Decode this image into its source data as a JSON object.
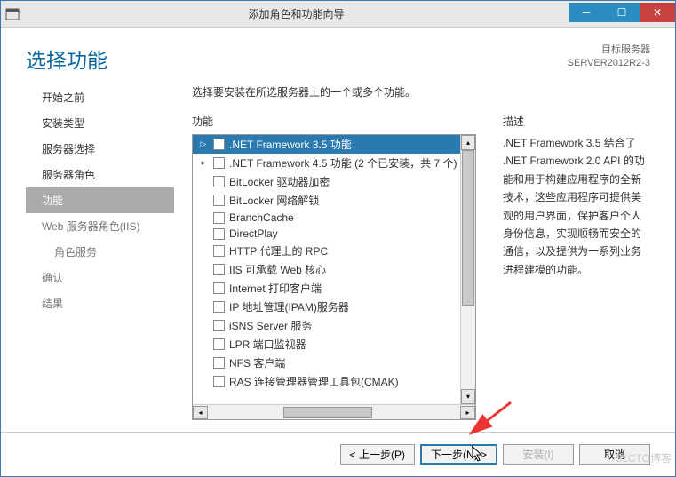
{
  "titlebar": {
    "text": "添加角色和功能向导"
  },
  "header": {
    "heading": "选择功能",
    "targetLabel": "目标服务器",
    "targetServer": "SERVER2012R2-3"
  },
  "sidebar": {
    "items": [
      {
        "label": "开始之前",
        "state": "done"
      },
      {
        "label": "安装类型",
        "state": "done"
      },
      {
        "label": "服务器选择",
        "state": "done"
      },
      {
        "label": "服务器角色",
        "state": "done"
      },
      {
        "label": "功能",
        "state": "active"
      },
      {
        "label": "Web 服务器角色(IIS)",
        "state": "normal"
      },
      {
        "label": "角色服务",
        "state": "normal",
        "sub": true
      },
      {
        "label": "确认",
        "state": "normal"
      },
      {
        "label": "结果",
        "state": "normal"
      }
    ]
  },
  "intro": "选择要安装在所选服务器上的一个或多个功能。",
  "featuresTitle": "功能",
  "descriptionTitle": "描述",
  "features": [
    {
      "label": ".NET Framework 3.5 功能",
      "selected": true,
      "expand": "▷"
    },
    {
      "label": ".NET Framework 4.5 功能 (2 个已安装，共 7 个)",
      "expand": "▸"
    },
    {
      "label": "BitLocker 驱动器加密"
    },
    {
      "label": "BitLocker 网络解锁"
    },
    {
      "label": "BranchCache"
    },
    {
      "label": "DirectPlay"
    },
    {
      "label": "HTTP 代理上的 RPC"
    },
    {
      "label": "IIS 可承载 Web 核心"
    },
    {
      "label": "Internet 打印客户端"
    },
    {
      "label": "IP 地址管理(IPAM)服务器"
    },
    {
      "label": "iSNS Server 服务"
    },
    {
      "label": "LPR 端口监视器"
    },
    {
      "label": "NFS 客户端"
    },
    {
      "label": "RAS 连接管理器管理工具包(CMAK)"
    }
  ],
  "description": ".NET Framework 3.5 结合了 .NET Framework 2.0 API 的功能和用于构建应用程序的全新技术，这些应用程序可提供美观的用户界面，保护客户个人身份信息，实现顺畅而安全的通信，以及提供为一系列业务进程建模的功能。",
  "buttons": {
    "prev": "< 上一步(P)",
    "next": "下一步(N) >",
    "install": "安装(I)",
    "cancel": "取消"
  },
  "watermark": "51CTO博客"
}
